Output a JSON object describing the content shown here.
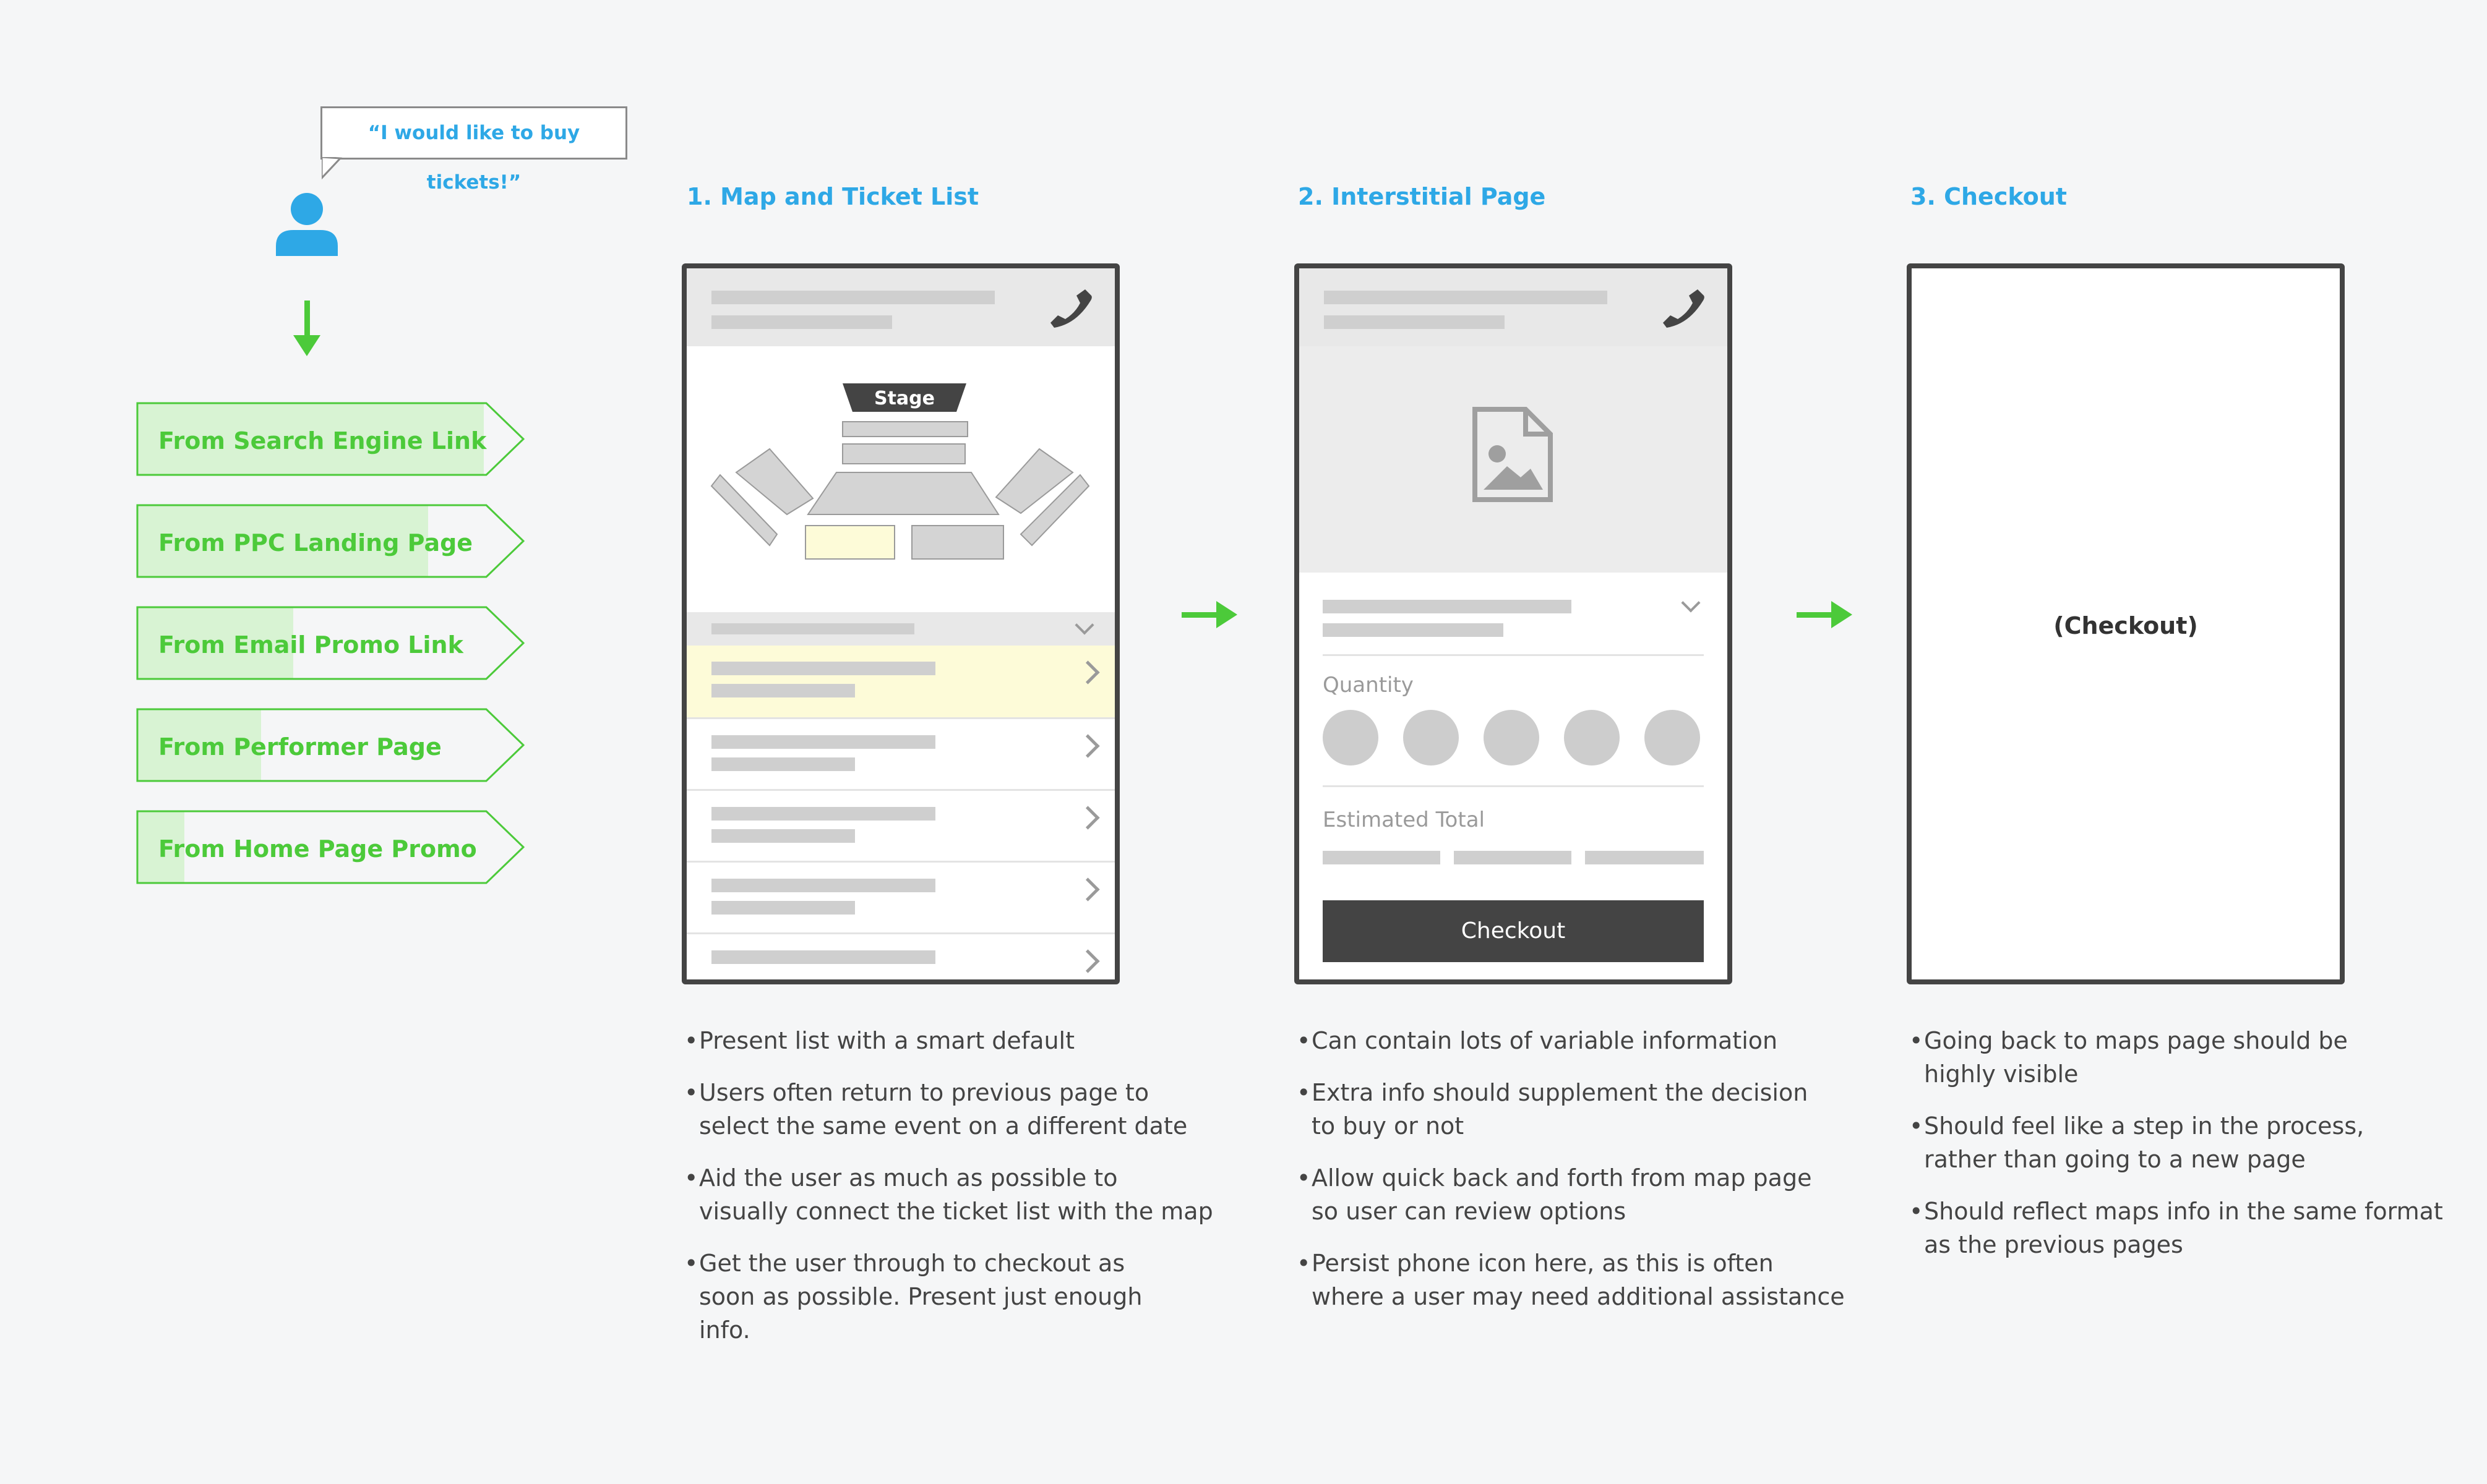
{
  "speech": "“I would like to buy tickets!”",
  "sources": [
    "From Search Engine Link",
    "From PPC Landing Page",
    "From Email Promo Link",
    "From Performer Page",
    "From Home Page Promo"
  ],
  "steps": [
    {
      "title": "1. Map and Ticket List",
      "stage_label": "Stage",
      "notes": [
        "Present list with a smart default",
        "Users often return to previous page to\nselect the same event on a different date",
        "Aid the user as much as possible to\nvisually connect the ticket list with the map",
        "Get the user through to checkout as\nsoon as possible. Present just enough\ninfo."
      ]
    },
    {
      "title": "2. Interstitial Page",
      "quantity_label": "Quantity",
      "total_label": "Estimated Total",
      "button_label": "Checkout",
      "notes": [
        "Can contain lots of variable information",
        "Extra info should supplement the decision\nto buy or not",
        "Allow quick back and forth from map page\nso user can review options",
        "Persist phone icon here, as this is often\nwhere a user may need additional assistance"
      ]
    },
    {
      "title": "3. Checkout",
      "placeholder": "(Checkout)",
      "notes": [
        "Going back to maps page should be\nhighly visible",
        "Should feel like a step in the process,\nrather than going to a new page",
        "Should reflect maps info in the same format\nas the previous pages"
      ]
    }
  ],
  "colors": {
    "accent_blue": "#2ea8e6",
    "accent_green": "#4cca3a",
    "highlight_yellow": "#fdfbd8",
    "frame": "#444444"
  }
}
